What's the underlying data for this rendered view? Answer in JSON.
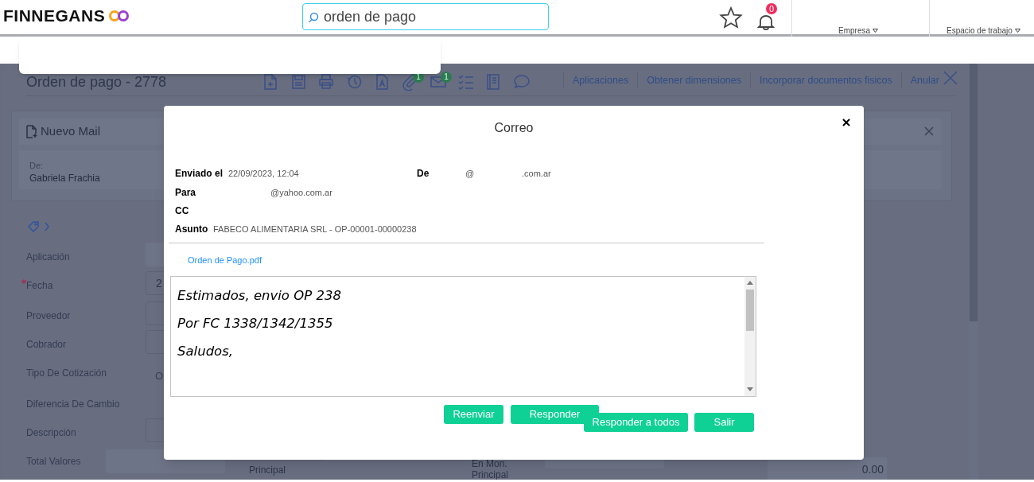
{
  "header": {
    "logo": "FINNEGANS",
    "search": {
      "value": "orden de pago"
    },
    "notifications": "0",
    "menus": [
      {
        "label": "Empresa"
      },
      {
        "label": "Espacio de trabajo"
      }
    ]
  },
  "document": {
    "title": "Orden de pago - 2778",
    "toolbar": [
      {
        "kind": "doc-add"
      },
      {
        "kind": "save"
      },
      {
        "kind": "print"
      },
      {
        "kind": "history"
      },
      {
        "kind": "doc-letter"
      },
      {
        "kind": "attach",
        "badge": "1"
      },
      {
        "kind": "mail",
        "badge": "1"
      },
      {
        "kind": "checklist"
      },
      {
        "kind": "book"
      },
      {
        "kind": "comment"
      }
    ],
    "actions": [
      "Aplicaciones",
      "Obtener dimensiones",
      "Incorporar documentos fisicos",
      "Anular"
    ],
    "mail_panel": {
      "title": "Nuevo Mail",
      "from_label": "De:",
      "from_value": "Gabriela Frachia"
    },
    "fields": [
      {
        "label": "Aplicación",
        "required": false,
        "kind": "filled"
      },
      {
        "label": "Fecha",
        "required": true,
        "kind": "input",
        "value": "2"
      },
      {
        "label": "Proveedor",
        "required": false,
        "kind": "input"
      },
      {
        "label": "Cobrador",
        "required": false,
        "kind": "input"
      },
      {
        "label": "Tipo De Cotización",
        "required": false,
        "kind": "plain",
        "value": "O"
      },
      {
        "label": "Diferencia De Cambio",
        "required": false,
        "kind": "plain"
      },
      {
        "label": "Descripción",
        "required": false,
        "kind": "input"
      },
      {
        "label": "Total Valores",
        "required": false,
        "kind": "filled"
      }
    ],
    "totals": [
      {
        "label": "Principal"
      },
      {
        "label": "En Mon. Principal"
      },
      {
        "value": "0.00"
      }
    ]
  },
  "modal": {
    "title": "Correo",
    "enviado_el": {
      "label": "Enviado el",
      "value": "22/09/2023, 12:04"
    },
    "de": {
      "label": "De",
      "parts": [
        "@",
        ".com.ar"
      ]
    },
    "para": {
      "label": "Para",
      "value": "@yahoo.com.ar"
    },
    "cc": {
      "label": "CC"
    },
    "asunto": {
      "label": "Asunto",
      "value": "FABECO ALIMENTARIA SRL - OP-00001-00000238"
    },
    "attachment": "Orden de Pago.pdf",
    "body": [
      "Estimados, envio OP 238",
      "Por FC 1338/1342/1355",
      "Saludos,"
    ],
    "buttons": [
      "Reenviar",
      "Responder",
      "Responder a todos",
      "Salir"
    ]
  }
}
